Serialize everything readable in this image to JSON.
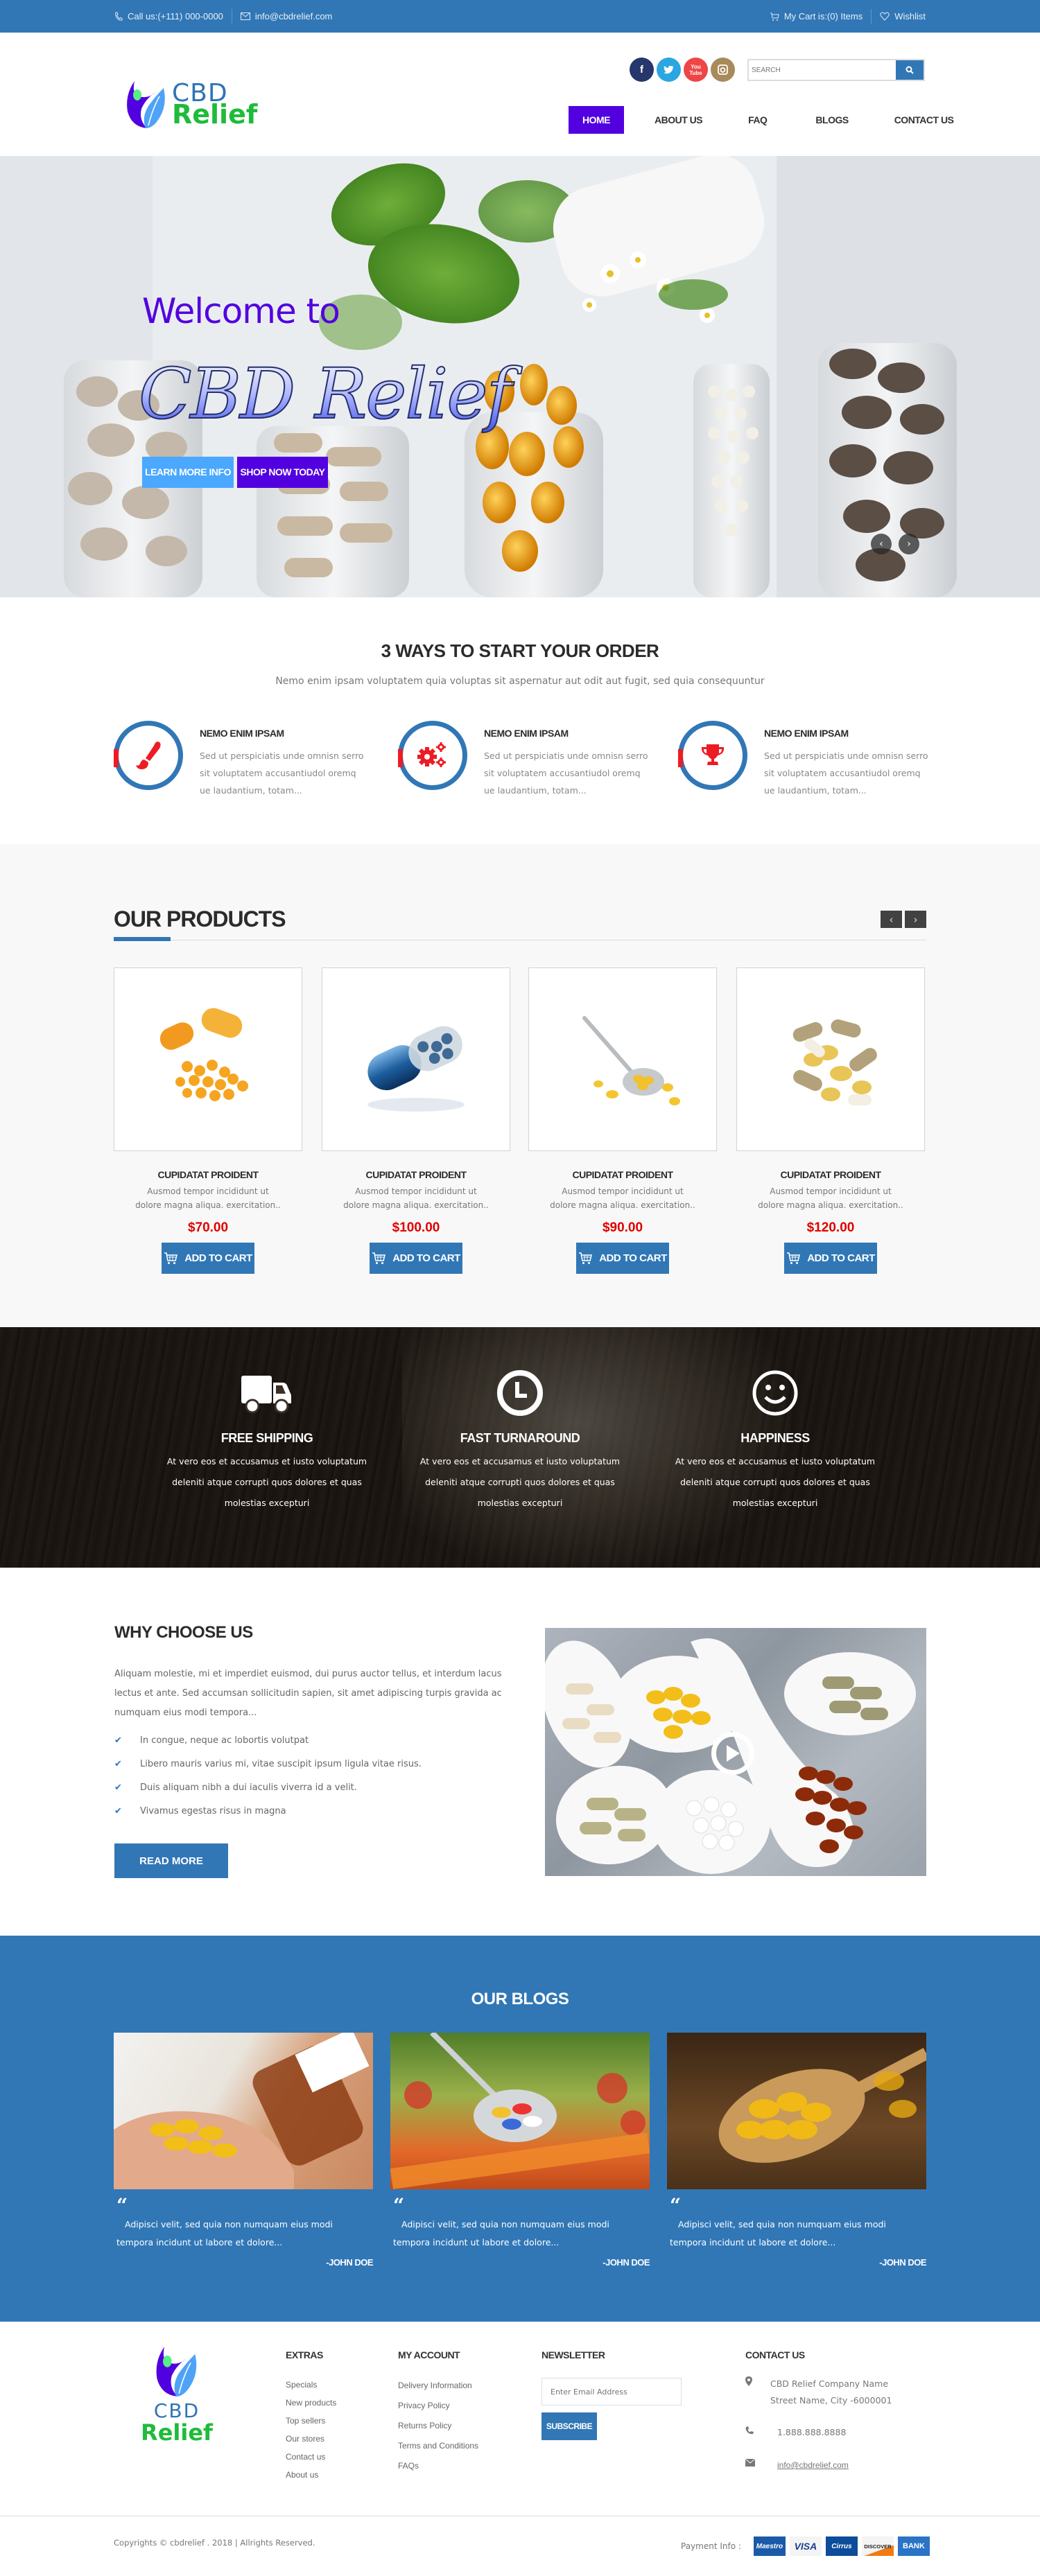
{
  "topbar": {
    "phone": "Call us:(+111) 000-0000",
    "email": "info@cbdrelief.com",
    "cart": "My Cart is:(0) Items",
    "wishlist": "Wishlist"
  },
  "header": {
    "logo_line1": "CBD",
    "logo_line2": "Relief",
    "social": [
      {
        "name": "facebook",
        "glyph": "f",
        "color": "#26376c"
      },
      {
        "name": "twitter",
        "glyph": "t",
        "color": "#2ba6e1"
      },
      {
        "name": "youtube",
        "glyph": "▶",
        "color": "#ee4646"
      },
      {
        "name": "instagram",
        "glyph": "◎",
        "color": "#a88a5b"
      }
    ],
    "search_placeholder": "SEARCH",
    "nav": [
      "HOME",
      "ABOUT US",
      "FAQ",
      "BLOGS",
      "CONTACT US"
    ],
    "active_nav": "HOME"
  },
  "hero": {
    "welcome": "Welcome to",
    "brand": "CBD Relief",
    "btn_learn": "LEARN MORE INFO",
    "btn_shop": "SHOP NOW TODAY",
    "prev": "‹",
    "next": "›"
  },
  "ways": {
    "title": "3 WAYS TO START YOUR ORDER",
    "subtitle": "Nemo enim ipsam voluptatem quia voluptas sit aspernatur aut odit aut fugit, sed quia consequuntur",
    "items": [
      {
        "icon": "paintbrush-icon",
        "title": "NEMO ENIM IPSAM",
        "text": "Sed ut perspiciatis unde omnisn serro sit voluptatem accusantiudol oremq ue laudantium, totam..."
      },
      {
        "icon": "gears-icon",
        "title": "NEMO ENIM IPSAM",
        "text": "Sed ut perspiciatis unde omnisn serro sit voluptatem accusantiudol oremq ue laudantium, totam..."
      },
      {
        "icon": "trophy-icon",
        "title": "NEMO ENIM IPSAM",
        "text": "Sed ut perspiciatis unde omnisn serro sit voluptatem accusantiudol oremq ue laudantium, totam..."
      }
    ]
  },
  "products": {
    "title": "OUR PRODUCTS",
    "items": [
      {
        "name": "CUPIDATAT PROIDENT",
        "desc": "Ausmod tempor incididunt ut dolore magna aliqua. exercitation..",
        "price": "$70.00",
        "button": "ADD TO CART"
      },
      {
        "name": "CUPIDATAT PROIDENT",
        "desc": "Ausmod tempor incididunt ut dolore magna aliqua. exercitation..",
        "price": "$100.00",
        "button": "ADD TO CART"
      },
      {
        "name": "CUPIDATAT PROIDENT",
        "desc": "Ausmod tempor incididunt ut dolore magna aliqua. exercitation..",
        "price": "$90.00",
        "button": "ADD TO CART"
      },
      {
        "name": "CUPIDATAT PROIDENT",
        "desc": "Ausmod tempor incididunt ut dolore magna aliqua. exercitation..",
        "price": "$120.00",
        "button": "ADD TO CART"
      }
    ]
  },
  "features": [
    {
      "icon": "truck-icon",
      "title": "FREE SHIPPING",
      "text": "At vero eos et accusamus et iusto voluptatum deleniti atque corrupti quos dolores et quas molestias excepturi"
    },
    {
      "icon": "clock-icon",
      "title": "FAST TURNAROUND",
      "text": "At vero eos et accusamus et iusto voluptatum deleniti atque corrupti quos dolores et quas molestias excepturi"
    },
    {
      "icon": "smiley-icon",
      "title": "HAPPINESS",
      "text": "At vero eos et accusamus et iusto voluptatum deleniti atque corrupti quos dolores et quas molestias excepturi"
    }
  ],
  "why": {
    "title": "WHY CHOOSE US",
    "intro": "Aliquam molestie, mi et imperdiet euismod, dui purus auctor tellus, et interdum lacus lectus et ante. Sed accumsan sollicitudin sapien, sit amet adipiscing turpis gravida ac numquam eius modi tempora...",
    "points": [
      "In congue, neque ac lobortis volutpat",
      "Libero mauris varius mi, vitae suscipit ipsum ligula vitae risus.",
      "Duis aliquam nibh a dui iaculis viverra id a velit.",
      "Vivamus egestas risus in magna"
    ],
    "button": "READ MORE"
  },
  "blogs": {
    "title": "OUR BLOGS",
    "items": [
      {
        "quote": "“",
        "text": "Adipisci velit, sed quia non numquam eius modi tempora incidunt ut labore et dolore...",
        "author": "-JOHN DOE"
      },
      {
        "quote": "“",
        "text": "Adipisci velit, sed quia non numquam eius modi tempora incidunt ut labore et dolore...",
        "author": "-JOHN DOE"
      },
      {
        "quote": "“",
        "text": "Adipisci velit, sed quia non numquam eius modi tempora incidunt ut labore et dolore...",
        "author": "-JOHN DOE"
      }
    ]
  },
  "footer": {
    "logo_line1": "CBD",
    "logo_line2": "Relief",
    "extras": {
      "title": "EXTRAS",
      "links": [
        "Specials",
        "New products",
        "Top sellers",
        "Our stores",
        "Contact us",
        "About us"
      ]
    },
    "account": {
      "title": "MY ACCOUNT",
      "links": [
        "Delivery Information",
        "Privacy Policy",
        "Returns Policy",
        "Terms and Conditions",
        "FAQs"
      ]
    },
    "newsletter": {
      "title": "NEWSLETTER",
      "placeholder": "Enter Email Address",
      "button": "SUBSCRIBE"
    },
    "contact": {
      "title": "CONTACT US",
      "address_line1": "CBD Relief Company Name",
      "address_line2": "Street Name, City -6000001",
      "phone": "1.888.888.8888",
      "email": "info@cbdrelief.com"
    },
    "copyright": "Copyrights © cbdrelief . 2018 | Allrights Reserved.",
    "payment_label": "Payment Info :",
    "payment_cards": [
      {
        "name": "Maestro",
        "bg": "#1b5aa8",
        "fg": "#fff"
      },
      {
        "name": "VISA",
        "bg": "#f4f4f4",
        "fg": "#1a3f8f"
      },
      {
        "name": "Cirrus",
        "bg": "#0d4b9b",
        "fg": "#fff"
      },
      {
        "name": "DISCOVER",
        "bg": "#f4f4f4",
        "fg": "#222"
      },
      {
        "name": "BANK",
        "bg": "#2a73c6",
        "fg": "#fff"
      }
    ]
  },
  "colors": {
    "primary": "#3177b6",
    "accent_purple": "#5300e0",
    "price_red": "#e00000",
    "icon_red": "#ed1c24",
    "logo_green": "#1fbb3b"
  }
}
